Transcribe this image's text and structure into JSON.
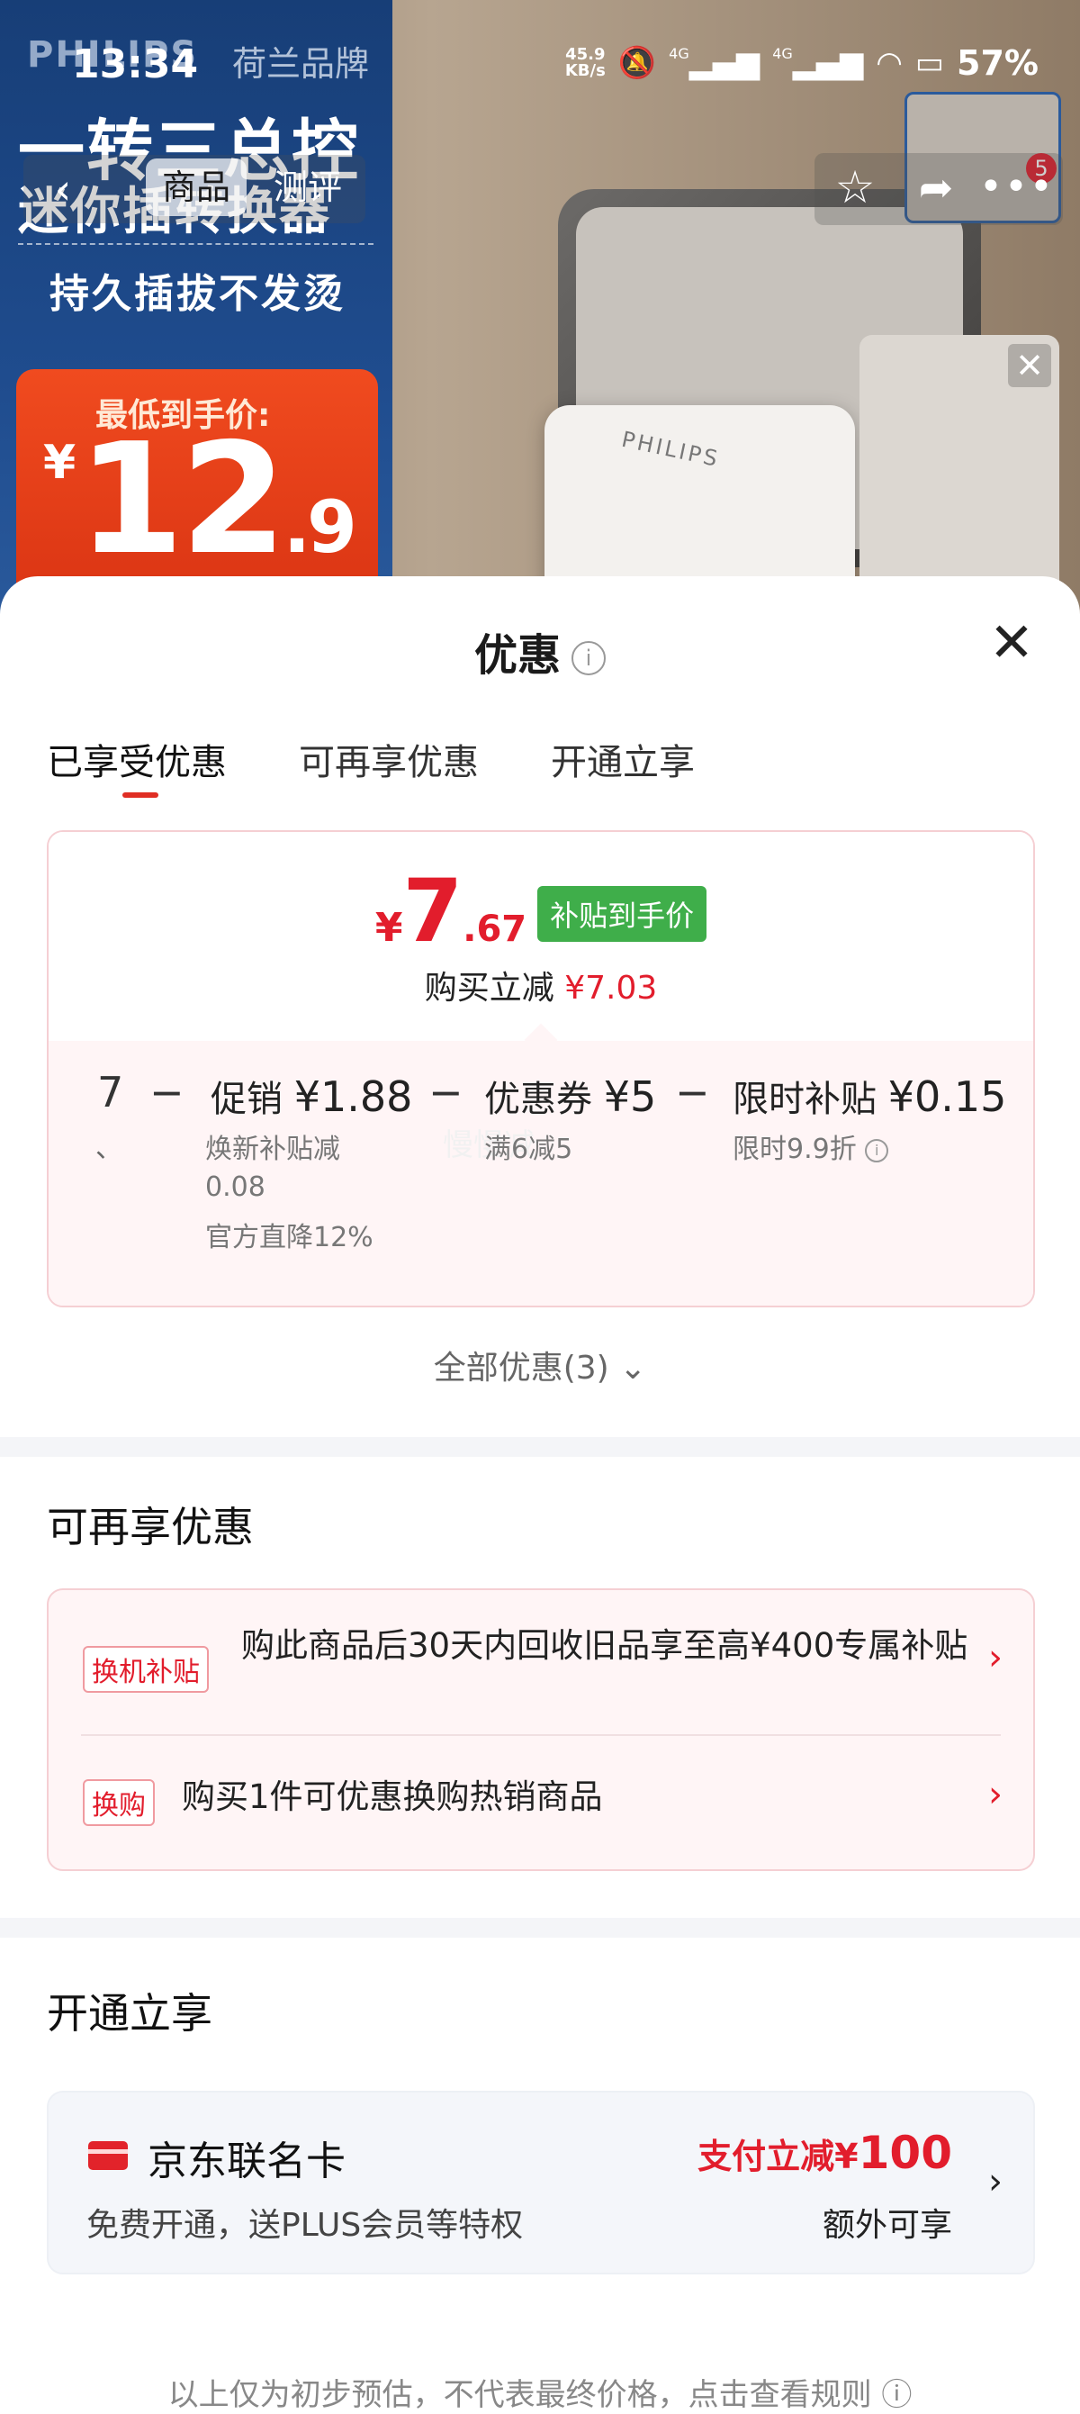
{
  "status_bar": {
    "time": "13:34",
    "net_speed_value": "45.9",
    "net_speed_unit": "KB/s",
    "signal_1": "4G",
    "signal_2": "4G",
    "battery": "57%"
  },
  "product_banner": {
    "logo": "PHILIPS",
    "brand": "荷兰品牌",
    "title": "一转三总控",
    "subtitle1": "迷你插转换器",
    "subtitle2": "持久插拔不发烫",
    "price_label": "最低到手价:",
    "price_currency": "¥",
    "price_int": "12",
    "price_dec": ".9",
    "adapter_logo": "PHILIPS",
    "thumb_badge": "5"
  },
  "top_nav": {
    "tab_goods": "商品",
    "tab_review": "测评"
  },
  "sheet": {
    "title": "优惠",
    "info_icon": "i",
    "tabs": [
      "已享受优惠",
      "可再享优惠",
      "开通立享"
    ],
    "final_price": {
      "currency": "¥",
      "int": "7",
      "dec": ".67",
      "tag": "补贴到手价"
    },
    "reduce_label": "购买立减",
    "reduce_amount": "¥7.03",
    "calc": {
      "base": "7",
      "base_sub": "、",
      "minus": "−",
      "item1_label": "促销",
      "item1_amount": "¥1.88",
      "item1_sub1": "焕新补贴减",
      "item1_sub2": "0.08",
      "item1_sub3": "官方直降12%",
      "item2_label": "优惠券",
      "item2_amount": "¥5",
      "item2_sub": "满6减5",
      "item2_ghost": "慢慢减",
      "item3_label": "限时补贴",
      "item3_amount": "¥0.15",
      "item3_sub": "限时9.9折"
    },
    "all_promo": "全部优惠(3)",
    "more_section_title": "可再享优惠",
    "more_items": [
      {
        "tag": "换机补贴",
        "text": "购此商品后30天内回收旧品享至高¥400专属补贴"
      },
      {
        "tag": "换购",
        "text": "购买1件可优惠换购热销商品"
      }
    ],
    "open_section_title": "开通立享",
    "jd_card": {
      "name": "京东联名卡",
      "desc": "免费开通，送PLUS会员等特权",
      "pay_prefix": "支付立减¥",
      "pay_amount": "100",
      "extra": "额外可享"
    },
    "footer": "以上仅为初步预估，不代表最终价格，点击查看规则"
  }
}
